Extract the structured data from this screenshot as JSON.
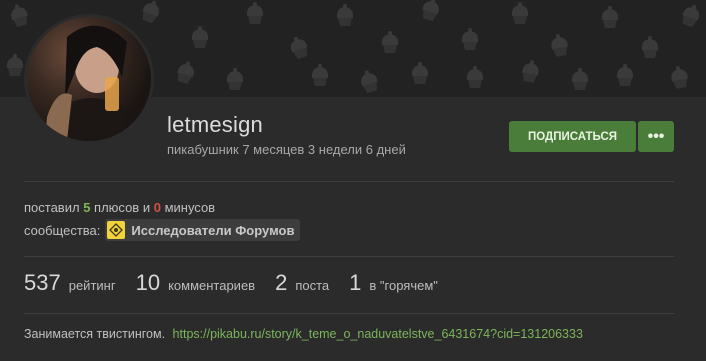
{
  "profile": {
    "username": "letmesign",
    "tenure": "пикабушник 7 месяцев 3 недели 6 дней",
    "avatar_icon": "user-avatar-photo"
  },
  "actions": {
    "subscribe_label": "ПОДПИСАТЬСЯ",
    "more_label": "•••"
  },
  "votes": {
    "prefix": "поставил",
    "plus_count": "5",
    "middle": "плюсов и",
    "minus_count": "0",
    "suffix": "минусов"
  },
  "communities": {
    "label": "сообщества:",
    "items": [
      {
        "name": "Исследователи Форумов",
        "icon": "forum-explorers-icon"
      }
    ]
  },
  "stats": [
    {
      "value": "537",
      "label": "рейтинг"
    },
    {
      "value": "10",
      "label": "комментариев"
    },
    {
      "value": "2",
      "label": "поста"
    },
    {
      "value": "1",
      "label": "в \"горячем\""
    }
  ],
  "about": {
    "text": "Занимается твистингом.",
    "link": "https://pikabu.ru/story/k_teme_o_naduvatelstve_6431674?cid=131206333"
  },
  "colors": {
    "accent_green": "#4b7d3a",
    "plus_green": "#7cb55a",
    "minus_red": "#d65040",
    "background": "#2b2b2b"
  }
}
